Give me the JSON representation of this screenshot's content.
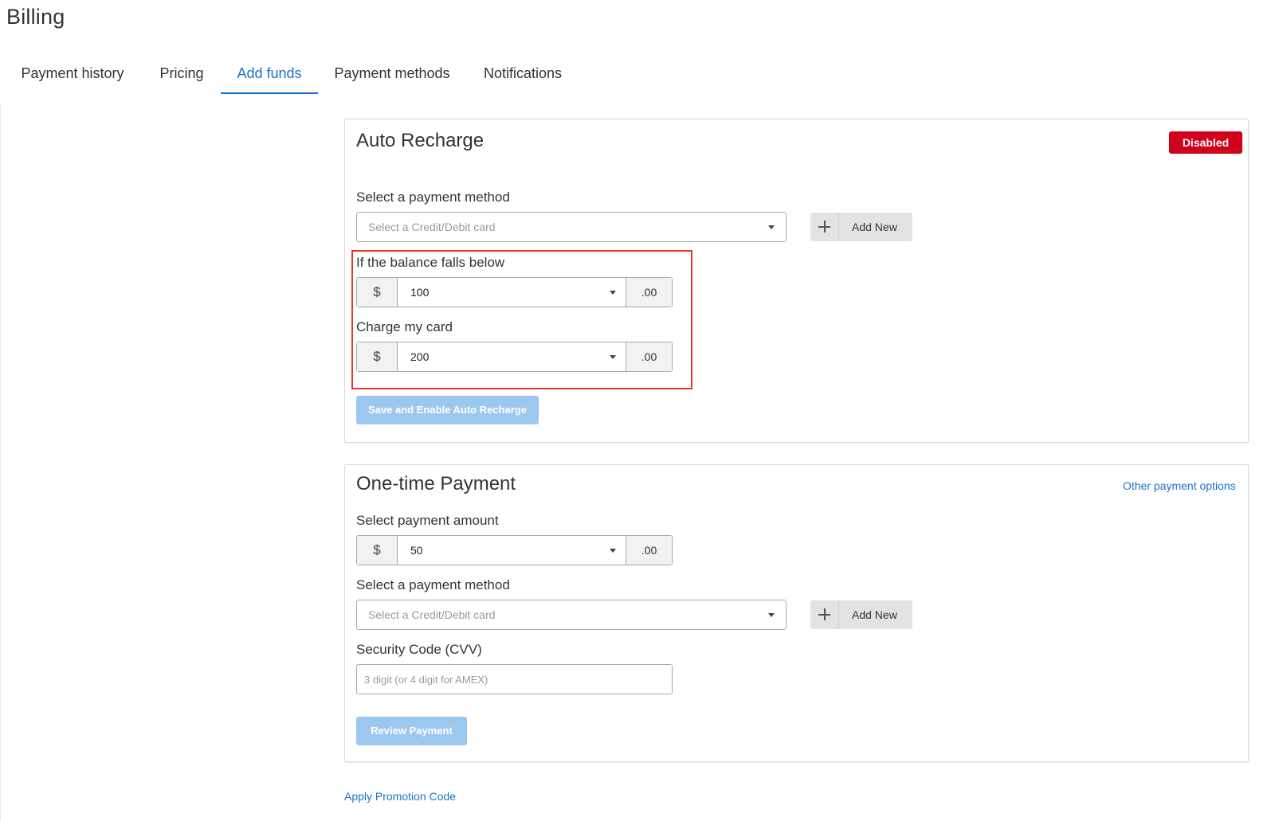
{
  "page": {
    "title": "Billing"
  },
  "tabs": [
    {
      "label": "Payment history",
      "active": false
    },
    {
      "label": "Pricing",
      "active": false
    },
    {
      "label": "Add funds",
      "active": true
    },
    {
      "label": "Payment methods",
      "active": false
    },
    {
      "label": "Notifications",
      "active": false
    }
  ],
  "auto_recharge": {
    "title": "Auto Recharge",
    "status_badge": "Disabled",
    "payment_method_label": "Select a payment method",
    "payment_method_placeholder": "Select a Credit/Debit card",
    "add_new_label": "Add New",
    "threshold_label": "If the balance falls below",
    "threshold_currency": "$",
    "threshold_value": "100",
    "threshold_cents": ".00",
    "charge_label": "Charge my card",
    "charge_currency": "$",
    "charge_value": "200",
    "charge_cents": ".00",
    "save_button": "Save and Enable Auto Recharge"
  },
  "one_time": {
    "title": "One-time Payment",
    "other_options_link": "Other payment options",
    "amount_label": "Select payment amount",
    "amount_currency": "$",
    "amount_value": "50",
    "amount_cents": ".00",
    "payment_method_label": "Select a payment method",
    "payment_method_placeholder": "Select a Credit/Debit card",
    "add_new_label": "Add New",
    "cvv_label": "Security Code (CVV)",
    "cvv_placeholder": "3 digit (or 4 digit for AMEX)",
    "review_button": "Review Payment"
  },
  "promo_link": "Apply Promotion Code",
  "colors": {
    "accent": "#1a73c9",
    "badge_disabled": "#d0021b",
    "button_disabled": "#9cc8ef",
    "highlight": "#e03a2b"
  }
}
